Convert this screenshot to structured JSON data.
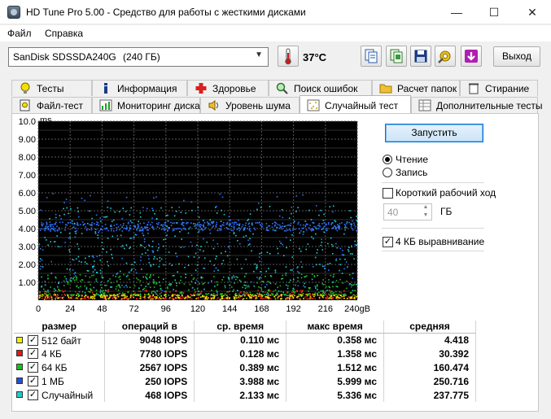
{
  "window": {
    "title": "HD Tune Pro 5.00 - Средство для работы с жесткими дисками",
    "minimize": "—",
    "maximize": "☐",
    "close": "✕"
  },
  "menu": {
    "file": "Файл",
    "help": "Справка"
  },
  "toolbar": {
    "drive_name": "SanDisk SDSSDA240G",
    "drive_capacity": "(240 ГБ)",
    "temperature": "37°C",
    "exit_label": "Выход"
  },
  "tabs_row1": [
    "Тесты",
    "Информация",
    "Здоровье",
    "Поиск ошибок",
    "Расчет папок",
    "Стирание"
  ],
  "tabs_row2": [
    "Файл-тест",
    "Мониторинг диска",
    "Уровень шума",
    "Случайный тест",
    "Дополнительные тесты"
  ],
  "active_tab": "Случайный тест",
  "controls": {
    "start_label": "Запустить",
    "read_label": "Чтение",
    "write_label": "Запись",
    "mode": "read",
    "short_stroke_label": "Короткий рабочий ход",
    "short_stroke_checked": false,
    "short_stroke_value": "40",
    "short_stroke_unit": "ГБ",
    "align_label": "4 КБ выравнивание",
    "align_checked": true
  },
  "chart_data": {
    "type": "scatter",
    "ylabel": "ms",
    "ylim": [
      0,
      10
    ],
    "xlim": [
      0,
      240
    ],
    "y_ticks": [
      "10.0",
      "9.00",
      "8.00",
      "7.00",
      "6.00",
      "5.00",
      "4.00",
      "3.00",
      "2.00",
      "1.00"
    ],
    "x_ticks": [
      "0",
      "24",
      "48",
      "72",
      "96",
      "120",
      "144",
      "168",
      "192",
      "216",
      "240gB"
    ],
    "background": "#000000",
    "grid": true,
    "series": [
      {
        "name": "512 байт",
        "color": "#e8e800",
        "band": [
          0.08,
          0.36
        ]
      },
      {
        "name": "4 КБ",
        "color": "#e02020",
        "band": [
          0.1,
          0.6
        ]
      },
      {
        "name": "64 КБ",
        "color": "#20c020",
        "band": [
          0.3,
          1.5
        ]
      },
      {
        "name": "1 МБ",
        "color": "#3070ff",
        "band": [
          3.9,
          4.4
        ],
        "scatter": [
          0.5,
          6.0
        ]
      },
      {
        "name": "Случайный",
        "color": "#20d0d0",
        "band": [
          0.3,
          5.3
        ]
      }
    ]
  },
  "results": {
    "headers": [
      "размер",
      "операций в",
      "ср. время",
      "макс время",
      "средняя"
    ],
    "rows": [
      {
        "name": "512 байт",
        "color": "#f2f200",
        "checked": true,
        "ops": "9048 IOPS",
        "avg": "0.110 мс",
        "max": "0.358 мс",
        "mean": "4.418"
      },
      {
        "name": "4 КБ",
        "color": "#e01818",
        "checked": true,
        "ops": "7780 IOPS",
        "avg": "0.128 мс",
        "max": "1.358 мс",
        "mean": "30.392"
      },
      {
        "name": "64 КБ",
        "color": "#18c018",
        "checked": true,
        "ops": "2567 IOPS",
        "avg": "0.389 мс",
        "max": "1.512 мс",
        "mean": "160.474"
      },
      {
        "name": "1 МБ",
        "color": "#2050e0",
        "checked": true,
        "ops": "250 IOPS",
        "avg": "3.988 мс",
        "max": "5.999 мс",
        "mean": "250.716"
      },
      {
        "name": "Случайный",
        "color": "#18d0d0",
        "checked": true,
        "ops": "468 IOPS",
        "avg": "2.133 мс",
        "max": "5.336 мс",
        "mean": "237.775"
      }
    ]
  }
}
